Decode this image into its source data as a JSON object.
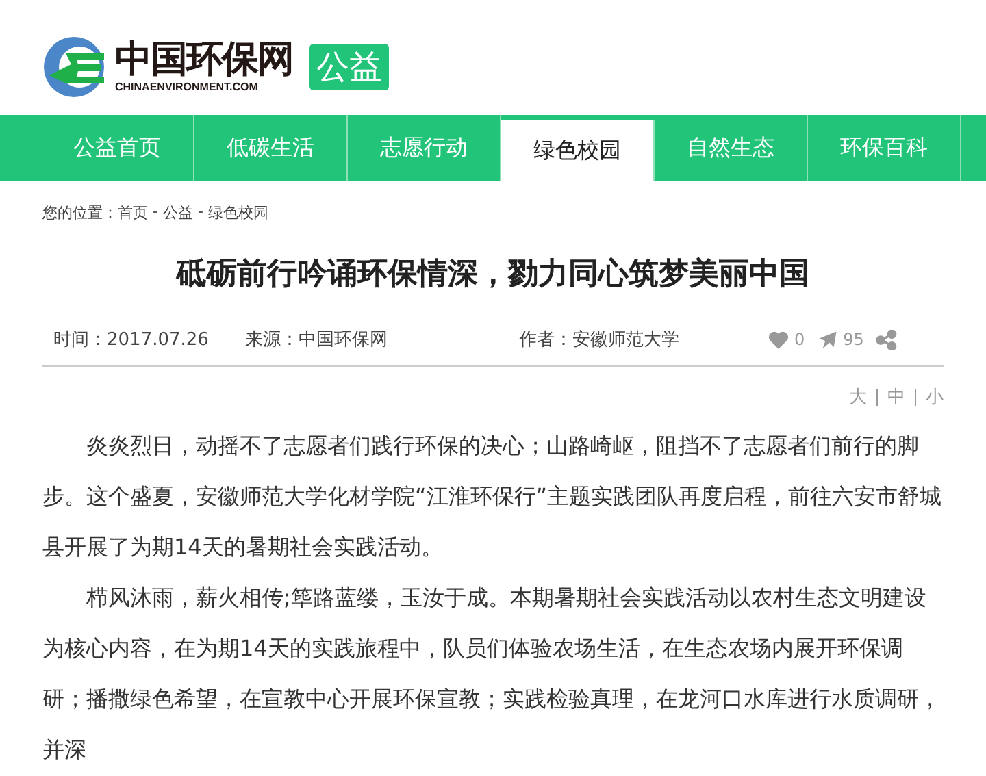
{
  "logo": {
    "name": "中国环保网",
    "domain": "CHINAENVIRONMENT.COM",
    "badge": "公益"
  },
  "nav": [
    {
      "label": "公益首页",
      "selected": false
    },
    {
      "label": "低碳生活",
      "selected": false
    },
    {
      "label": "志愿行动",
      "selected": false
    },
    {
      "label": "绿色校园",
      "selected": true
    },
    {
      "label": "自然生态",
      "selected": false
    },
    {
      "label": "环保百科",
      "selected": false
    }
  ],
  "breadcrumb": {
    "prefix": "您的位置：",
    "items": [
      "首页",
      "公益",
      "绿色校园"
    ],
    "separator": "-"
  },
  "article": {
    "title": "砥砺前行吟诵环保情深，勠力同心筑梦美丽中国",
    "time": "时间：2017.07.26",
    "source": "来源：中国环保网",
    "author": "作者：安徽师范大学",
    "likes": "0",
    "shares": "95",
    "font_sizes": [
      "大",
      "中",
      "小"
    ],
    "paragraphs": [
      "炎炎烈日，动摇不了志愿者们践行环保的决心；山路崎岖，阻挡不了志愿者们前行的脚步。这个盛夏，安徽师范大学化材学院“江淮环保行”主题实践团队再度启程，前往六安市舒城县开展了为期14天的暑期社会实践活动。",
      "栉风沐雨，薪火相传;筚路蓝缕，玉汝于成。本期暑期社会实践活动以农村生态文明建设为核心内容，在为期14天的实践旅程中，队员们体验农场生活，在生态农场内展开环保调研；播撒绿色希望，在宣教中心开展环保宣教；实践检验真理，在龙河口水库进行水质调研，并深"
    ]
  }
}
